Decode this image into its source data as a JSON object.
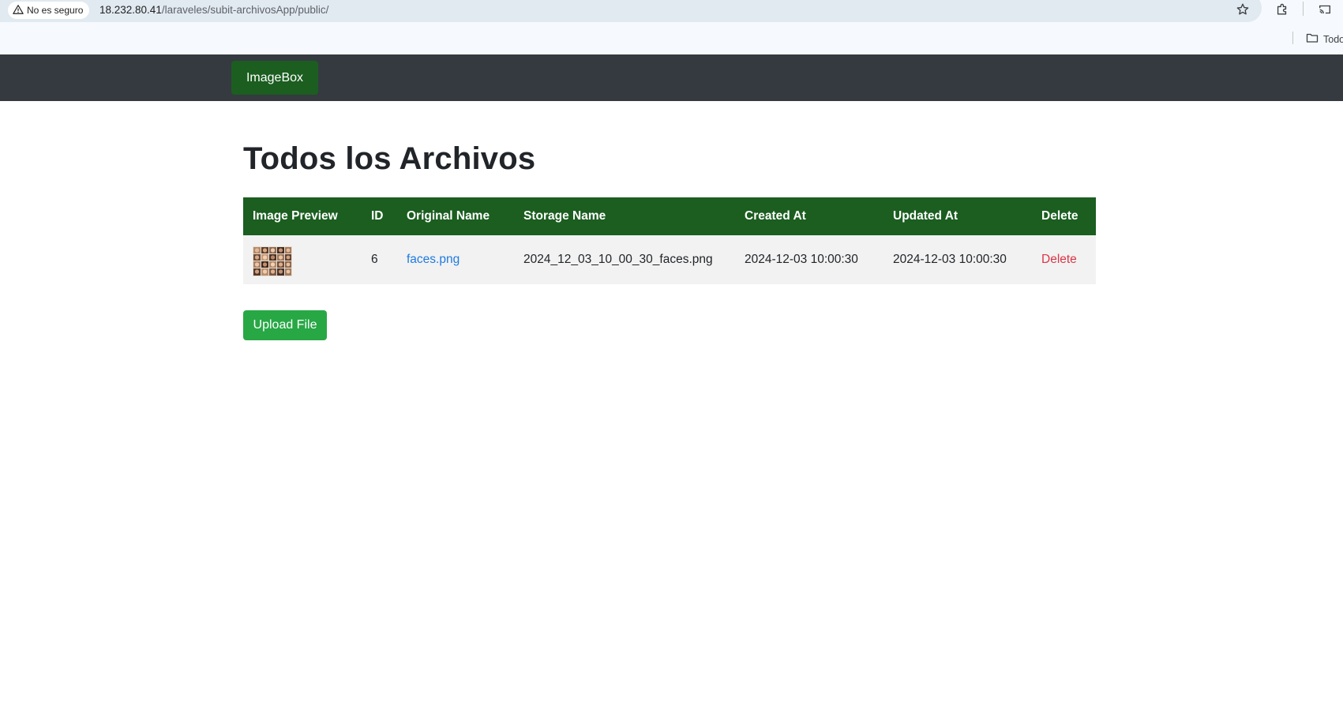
{
  "browser": {
    "security_label": "No es seguro",
    "url_host": "18.232.80.41",
    "url_path": "/laraveles/subit-archivosApp/public/",
    "bookmark_folder": "Todos"
  },
  "navbar": {
    "brand": "ImageBox"
  },
  "page": {
    "title": "Todos los Archivos"
  },
  "table": {
    "headers": [
      "Image Preview",
      "ID",
      "Original Name",
      "Storage Name",
      "Created At",
      "Updated At",
      "Delete"
    ],
    "rows": [
      {
        "id": "6",
        "original_name": "faces.png",
        "storage_name": "2024_12_03_10_00_30_faces.png",
        "created_at": "2024-12-03 10:00:30",
        "updated_at": "2024-12-03 10:00:30",
        "delete_label": "Delete"
      }
    ]
  },
  "actions": {
    "upload_label": "Upload File"
  },
  "colors": {
    "navbar": "#343a40",
    "brand_bg": "#1b5e20",
    "table_header": "#1b5e20",
    "row_bg": "#f2f2f2",
    "link": "#1e7be0",
    "delete": "#dc3545",
    "upload_button": "#28a745"
  },
  "icons": {
    "security": "warning-triangle-icon",
    "bookmark_star": "star-icon",
    "extensions": "puzzle-icon",
    "cast": "cast-icon",
    "folder": "folder-icon"
  }
}
